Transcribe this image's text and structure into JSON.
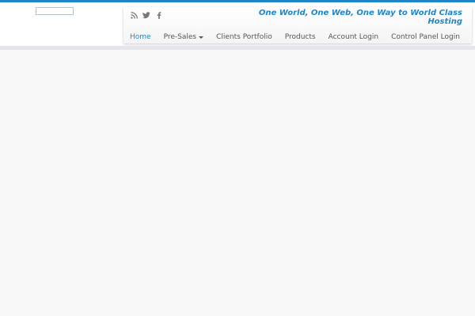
{
  "colors": {
    "accent": "#1e86c8",
    "nav_text": "#555555",
    "background": "#f8f8f9"
  },
  "header": {
    "tagline": "One World, One Web, One Way to World Class Hosting",
    "social_icons": [
      "rss-icon",
      "twitter-icon",
      "facebook-icon"
    ]
  },
  "nav": {
    "items": [
      {
        "label": "Home"
      },
      {
        "label": "Pre-Sales"
      },
      {
        "label": "Clients Portfolio"
      },
      {
        "label": "Products"
      },
      {
        "label": "Account Login"
      },
      {
        "label": "Control Panel Login"
      }
    ]
  }
}
